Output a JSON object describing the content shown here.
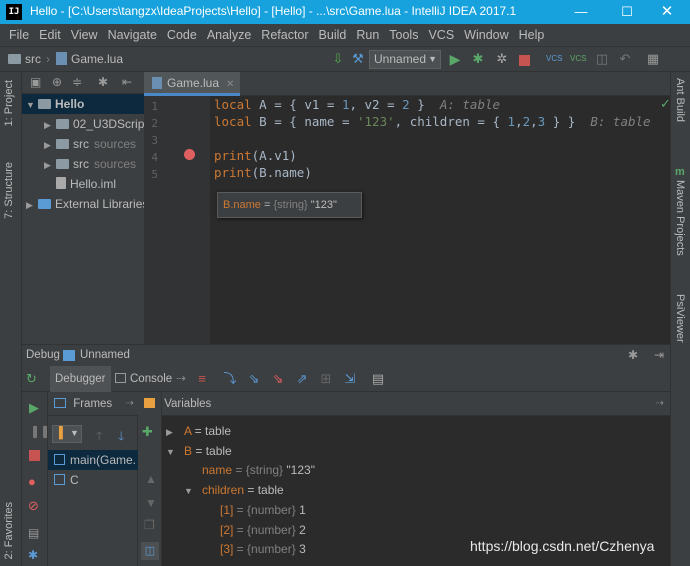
{
  "window": {
    "title": "Hello - [C:\\Users\\tangzx\\IdeaProjects\\Hello] - [Hello] - ...\\src\\Game.lua - IntelliJ IDEA 2017.1",
    "app_icon": "IJ"
  },
  "menu": [
    "File",
    "Edit",
    "View",
    "Navigate",
    "Code",
    "Analyze",
    "Refactor",
    "Build",
    "Run",
    "Tools",
    "VCS",
    "Window",
    "Help"
  ],
  "navbar": {
    "crumbs": [
      "src",
      "Game.lua"
    ],
    "run_config": "Unnamed"
  },
  "left_tabs": [
    "1: Project",
    "7: Structure",
    "2: Favorites"
  ],
  "right_tabs": [
    "Ant Build",
    "Maven Projects",
    "PsiViewer"
  ],
  "project_tree": [
    {
      "label": "Hello",
      "suffix": "",
      "level": 0,
      "arrow": "▼"
    },
    {
      "label": "02_U3DScrip",
      "suffix": "",
      "level": 1,
      "arrow": "▶"
    },
    {
      "label": "src",
      "suffix": "sources",
      "level": 1,
      "arrow": "▶"
    },
    {
      "label": "src",
      "suffix": "sources",
      "level": 1,
      "arrow": "▶"
    },
    {
      "label": "Hello.iml",
      "suffix": "",
      "level": 1,
      "arrow": ""
    },
    {
      "label": "External Libraries",
      "suffix": "",
      "level": 0,
      "arrow": "▶"
    }
  ],
  "editor": {
    "tab": "Game.lua",
    "line_numbers": [
      "1",
      "2",
      "3",
      "4",
      "5"
    ],
    "lines": [
      [
        {
          "t": "local",
          "c": "kw"
        },
        {
          "t": " A = { v1 = ",
          "c": ""
        },
        {
          "t": "1",
          "c": "num"
        },
        {
          "t": ", v2 = ",
          "c": ""
        },
        {
          "t": "2",
          "c": "num"
        },
        {
          "t": " }  ",
          "c": ""
        },
        {
          "t": "A: table",
          "c": "hint"
        }
      ],
      [
        {
          "t": "local",
          "c": "kw"
        },
        {
          "t": " B = { name = ",
          "c": ""
        },
        {
          "t": "'123'",
          "c": "str"
        },
        {
          "t": ", children = { ",
          "c": ""
        },
        {
          "t": "1",
          "c": "num"
        },
        {
          "t": ",",
          "c": ""
        },
        {
          "t": "2",
          "c": "num"
        },
        {
          "t": ",",
          "c": ""
        },
        {
          "t": "3",
          "c": "num"
        },
        {
          "t": " } }  ",
          "c": ""
        },
        {
          "t": "B: table",
          "c": "hint"
        }
      ],
      [],
      [
        {
          "t": "print",
          "c": "fn"
        },
        {
          "t": "(A.v1)",
          "c": ""
        }
      ],
      [
        {
          "t": "print",
          "c": "fn"
        },
        {
          "t": "(B.name)",
          "c": ""
        }
      ]
    ],
    "tooltip": {
      "name": "B.name",
      "eq": " = ",
      "type": "{string}",
      "value": " \"123\""
    }
  },
  "debug": {
    "title": "Debug",
    "config": "Unnamed",
    "tabs": [
      "Debugger",
      "Console"
    ],
    "frames_title": "Frames",
    "variables_title": "Variables",
    "frames": [
      "main(Game.",
      "C"
    ],
    "variables": [
      {
        "indent": 0,
        "arrow": "▶",
        "name": "A",
        "type": "",
        "value": " = table"
      },
      {
        "indent": 0,
        "arrow": "▼",
        "name": "B",
        "type": "",
        "value": " = table"
      },
      {
        "indent": 1,
        "arrow": "",
        "name": "name",
        "type": " = {string} ",
        "value": "\"123\""
      },
      {
        "indent": 1,
        "arrow": "▼",
        "name": "children",
        "type": "",
        "value": " = table"
      },
      {
        "indent": 2,
        "arrow": "",
        "name": "[1]",
        "type": " = {number} ",
        "value": "1"
      },
      {
        "indent": 2,
        "arrow": "",
        "name": "[2]",
        "type": " = {number} ",
        "value": "2"
      },
      {
        "indent": 2,
        "arrow": "",
        "name": "[3]",
        "type": " = {number} ",
        "value": "3"
      }
    ]
  },
  "watermark": "https://blog.csdn.net/Czhenya",
  "colors": {
    "titlebar": "#17a2dd",
    "selection": "#214283",
    "keyword": "#cc7832",
    "number": "#6897bb",
    "string": "#6a8759"
  }
}
